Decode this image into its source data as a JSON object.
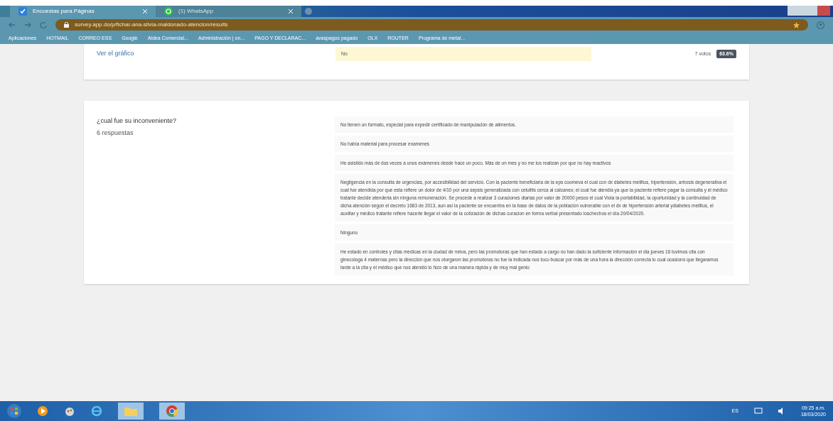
{
  "browser": {
    "tabs": [
      {
        "title": "Encuestas para Páginas",
        "selected": true,
        "kind": "survey"
      },
      {
        "title": "(1) WhatsApp",
        "selected": false,
        "kind": "chat"
      }
    ],
    "url": "survey.app.do/p/fichar-ana-silvia-maldonado-atencion/results",
    "bookmarks": [
      "Aplicaciones",
      "HOTMAIL",
      "CORREO ESS",
      "Google",
      "Aldea Comercial...",
      "Administración | on...",
      "PAGO Y DECLARAC...",
      "avaspagos pagado",
      "OLX",
      "ROUTER",
      "Programa de metal..."
    ]
  },
  "previous_card": {
    "link": "Ver el gráfico",
    "option": {
      "label": "No",
      "votes": "7 votos",
      "percent": "63.6%"
    }
  },
  "question": {
    "title": "¿cual fue su inconveniente?",
    "count": "6 respuestas",
    "responses": [
      "No tienen un formato, especial para expedir certificado de manipulación de alimentos.",
      "No había material para procesar examenes",
      "He asistido más de dos veces a unos exámenes desde hace un poco. Más de un mes y no me los realizan por que no hay reactivos",
      "Negligencia en la consulta de urgencias, por accesibilidad del servicio. Con la paciente beneficiaria de la eps coomeva el cual con dx diabetes mellitus, hipertensión, artrosis degenerativa el cual fue atendida por que esta refiere un dolor de 4/10 por una sepsis generalizada con celulitis cerca al calcaneo; el cual fue atendia ya que la paciente refiere pagar la consulta y el médico tratante decide atenderla sin ninguna remuneración. Se procede a realizar 3 curaciones diarias por valor de 20000 pesos el cual Viola la portabilidad, la oportunidad y la continuidad de dicha atención según el decreto 1683 de 2013, aun así la paciente se encuentra en la base de datos de la población vulnerable con el dx de hipertensión arterial ydiabetes mellitus, el auxiliar y médico tratante refiere hacerle llegar el valor de la cotización de dichas curacion en forma verbal presentado loschechos el día 20/04/2020.",
      "Ninguno",
      "He estado en controles y citas medicas en la ciudad de neiva, pero las promotoras que han estado a cargo no han dado la suficiente información el dia jueves 16 tuvimos cita con ginecologa 4 maternas pero la dirección que nos otorgaron las promotoras no fue la indicada nos toco buscar por más de una hora la dirección correcta lo cual ocasionó que llegaramos tarde a la cita y el médico que nos atendió lo hizo de una manera rápida y de muy mal genio"
    ]
  },
  "taskbar": {
    "language": "ES",
    "time": "09:25 a.m.",
    "date": "18/03/2020"
  }
}
